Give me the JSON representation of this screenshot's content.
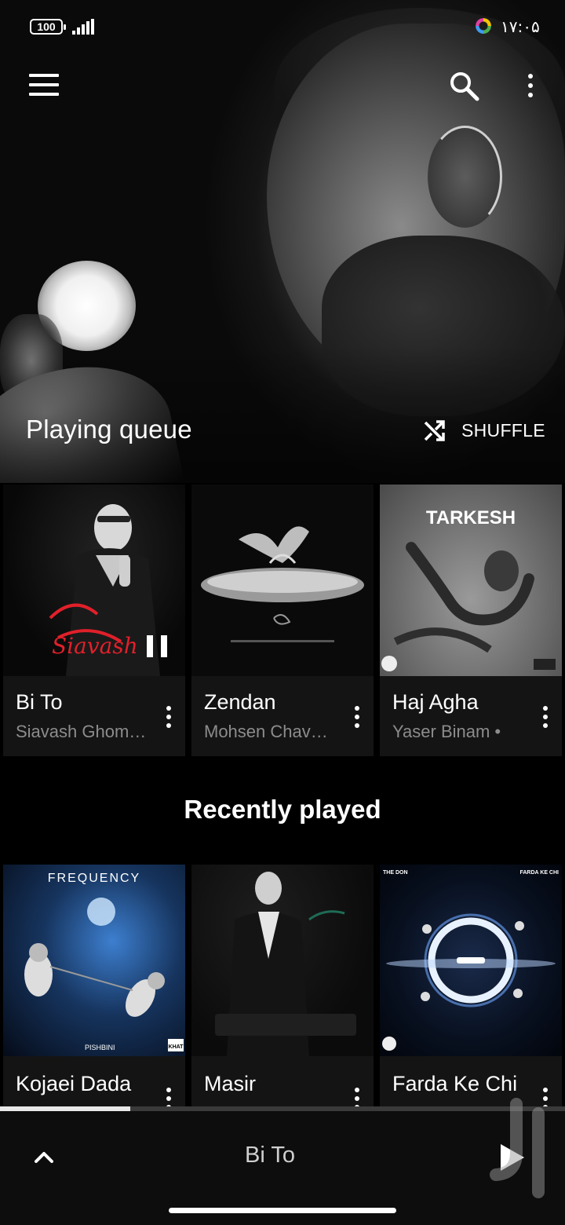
{
  "status_bar": {
    "battery": "100",
    "time": "۱۷:۰۵"
  },
  "header": {
    "queue_title": "Playing queue",
    "shuffle_label": "SHUFFLE"
  },
  "queue": [
    {
      "title": "Bi To",
      "artist": "Siavash Ghomayshi",
      "art_text": "Siavash",
      "playing": true
    },
    {
      "title": "Zendan",
      "artist": "Mohsen Chavoshi"
    },
    {
      "title": "Haj Agha",
      "artist": "Yaser Binam •",
      "art_text": "TARKESH"
    }
  ],
  "recent": {
    "title": "Recently played",
    "items": [
      {
        "title": "Kojaei Dada",
        "art_text": "FREQUENCY",
        "art_sub": "PISHBINI",
        "art_badge": "KHAT"
      },
      {
        "title": "Masir"
      },
      {
        "title": "Farda Ke Chi",
        "art_left": "THE DON",
        "art_right": "FARDA KE CHI"
      }
    ]
  },
  "player": {
    "now_playing": "Bi To",
    "progress": 0.23
  },
  "colors": {
    "background": "#000000",
    "card": "#141414",
    "secondary_text": "#8c8c8c",
    "progress_fill": "#e8e8e8"
  }
}
